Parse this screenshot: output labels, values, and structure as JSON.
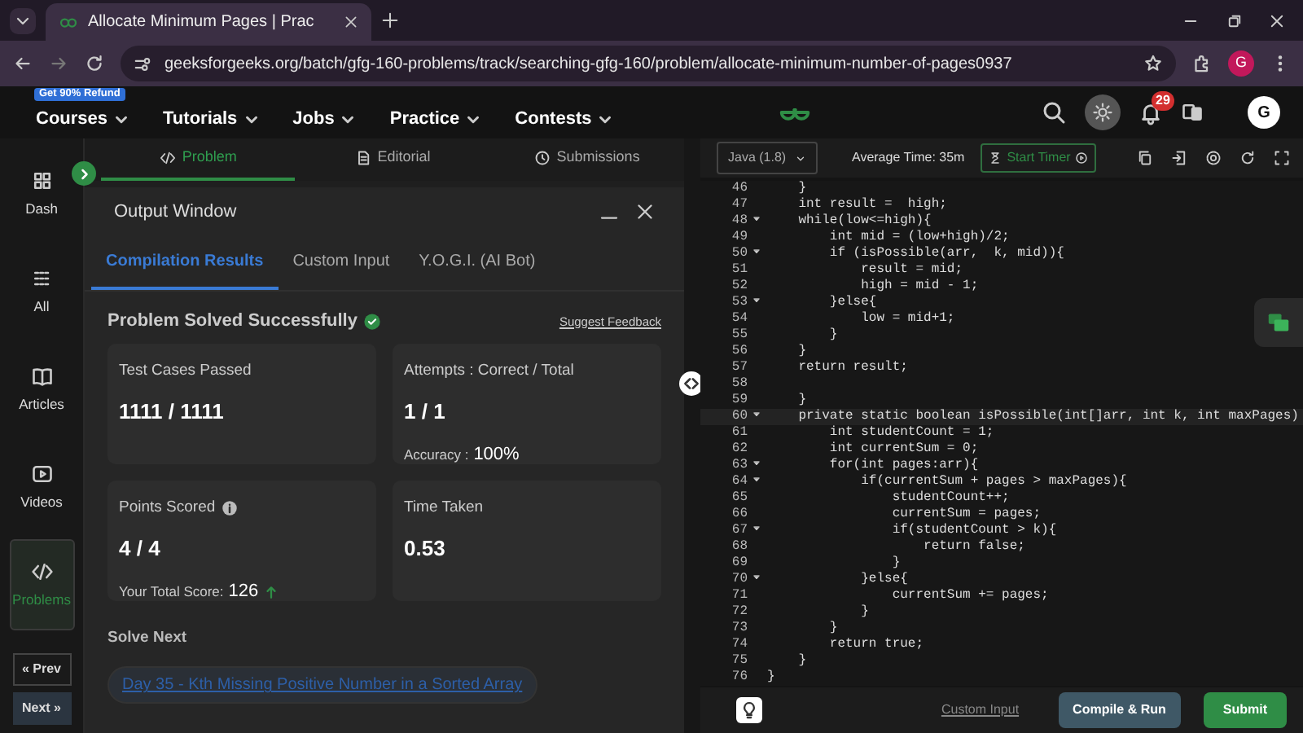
{
  "browser": {
    "tab_title": "Allocate Minimum Pages | Prac",
    "url": "geeksforgeeks.org/batch/gfg-160-problems/track/searching-gfg-160/problem/allocate-minimum-number-of-pages0937",
    "profile": "G"
  },
  "site_nav": {
    "promo": "Get 90% Refund",
    "menus": [
      "Courses",
      "Tutorials",
      "Jobs",
      "Practice",
      "Contests"
    ],
    "notifications": "29",
    "avatar": "G"
  },
  "sidebar": {
    "items": [
      {
        "label": "Dash",
        "selected": false
      },
      {
        "label": "All",
        "selected": false
      },
      {
        "label": "Articles",
        "selected": false
      },
      {
        "label": "Videos",
        "selected": false
      },
      {
        "label": "Problems",
        "selected": true
      }
    ],
    "prev": "« Prev",
    "next": "Next »"
  },
  "problem_tabs": [
    {
      "label": "Problem",
      "selected": true
    },
    {
      "label": "Editorial",
      "selected": false
    },
    {
      "label": "Submissions",
      "selected": false
    }
  ],
  "output": {
    "title": "Output Window",
    "tabs": [
      {
        "label": "Compilation Results",
        "selected": true
      },
      {
        "label": "Custom Input",
        "selected": false
      },
      {
        "label": "Y.O.G.I. (AI Bot)",
        "selected": false
      }
    ],
    "status": "Problem Solved Successfully",
    "feedback": "Suggest Feedback",
    "cards": [
      {
        "kind": "plain",
        "label": "Test Cases Passed",
        "value": "1111 / 1111"
      },
      {
        "kind": "note",
        "label": "Attempts : Correct / Total",
        "value": "1 / 1",
        "note_label": "Accuracy :",
        "note_value": "100%"
      },
      {
        "kind": "score",
        "label": "Points Scored",
        "value": "4 / 4",
        "note_label": "Your Total Score:",
        "note_value": "126"
      },
      {
        "kind": "plain",
        "label": "Time Taken",
        "value": "0.53"
      }
    ],
    "solve_next_title": "Solve Next",
    "solve_next": "Day 35 - Kth Missing Positive Number in a Sorted Array"
  },
  "editor": {
    "language": "Java (1.8)",
    "average_time": "Average Time: 35m",
    "timer": "Start Timer",
    "lines": [
      {
        "n": "46",
        "text": "    }",
        "fold": false,
        "current": false
      },
      {
        "n": "47",
        "text": "    int result =  high;",
        "fold": false,
        "current": false
      },
      {
        "n": "48",
        "text": "    while(low<=high){",
        "fold": true,
        "current": false
      },
      {
        "n": "49",
        "text": "        int mid = (low+high)/2;",
        "fold": false,
        "current": false
      },
      {
        "n": "50",
        "text": "        if (isPossible(arr,  k, mid)){",
        "fold": true,
        "current": false
      },
      {
        "n": "51",
        "text": "            result = mid;",
        "fold": false,
        "current": false
      },
      {
        "n": "52",
        "text": "            high = mid - 1;",
        "fold": false,
        "current": false
      },
      {
        "n": "53",
        "text": "        }else{",
        "fold": true,
        "current": false
      },
      {
        "n": "54",
        "text": "            low = mid+1;",
        "fold": false,
        "current": false
      },
      {
        "n": "55",
        "text": "        }",
        "fold": false,
        "current": false
      },
      {
        "n": "56",
        "text": "    }",
        "fold": false,
        "current": false
      },
      {
        "n": "57",
        "text": "    return result;",
        "fold": false,
        "current": false
      },
      {
        "n": "58",
        "fold": false,
        "current": false
      },
      {
        "n": "59",
        "text": "    }",
        "fold": false,
        "current": false
      },
      {
        "n": "60",
        "text": "    private static boolean isPossible(int[]arr, int k, int maxPages)",
        "fold": true,
        "current": true
      },
      {
        "n": "61",
        "text": "        int studentCount = 1;",
        "fold": false,
        "current": false
      },
      {
        "n": "62",
        "text": "        int currentSum = 0;",
        "fold": false,
        "current": false
      },
      {
        "n": "63",
        "text": "        for(int pages:arr){",
        "fold": true,
        "current": false
      },
      {
        "n": "64",
        "text": "            if(currentSum + pages > maxPages){",
        "fold": true,
        "current": false
      },
      {
        "n": "65",
        "text": "                studentCount++;",
        "fold": false,
        "current": false
      },
      {
        "n": "66",
        "text": "                currentSum = pages;",
        "fold": false,
        "current": false
      },
      {
        "n": "67",
        "text": "                if(studentCount > k){",
        "fold": true,
        "current": false
      },
      {
        "n": "68",
        "text": "                    return false;",
        "fold": false,
        "current": false
      },
      {
        "n": "69",
        "text": "                }",
        "fold": false,
        "current": false
      },
      {
        "n": "70",
        "text": "            }else{",
        "fold": true,
        "current": false
      },
      {
        "n": "71",
        "text": "                currentSum += pages;",
        "fold": false,
        "current": false
      },
      {
        "n": "72",
        "text": "            }",
        "fold": false,
        "current": false
      },
      {
        "n": "73",
        "text": "        }",
        "fold": false,
        "current": false
      },
      {
        "n": "74",
        "text": "        return true;",
        "fold": false,
        "current": false
      },
      {
        "n": "75",
        "text": "    }",
        "fold": false,
        "current": false
      },
      {
        "n": "76",
        "text": "}",
        "fold": false,
        "current": false
      }
    ],
    "custom_input": "Custom Input",
    "compile": "Compile & Run",
    "submit": "Submit"
  }
}
